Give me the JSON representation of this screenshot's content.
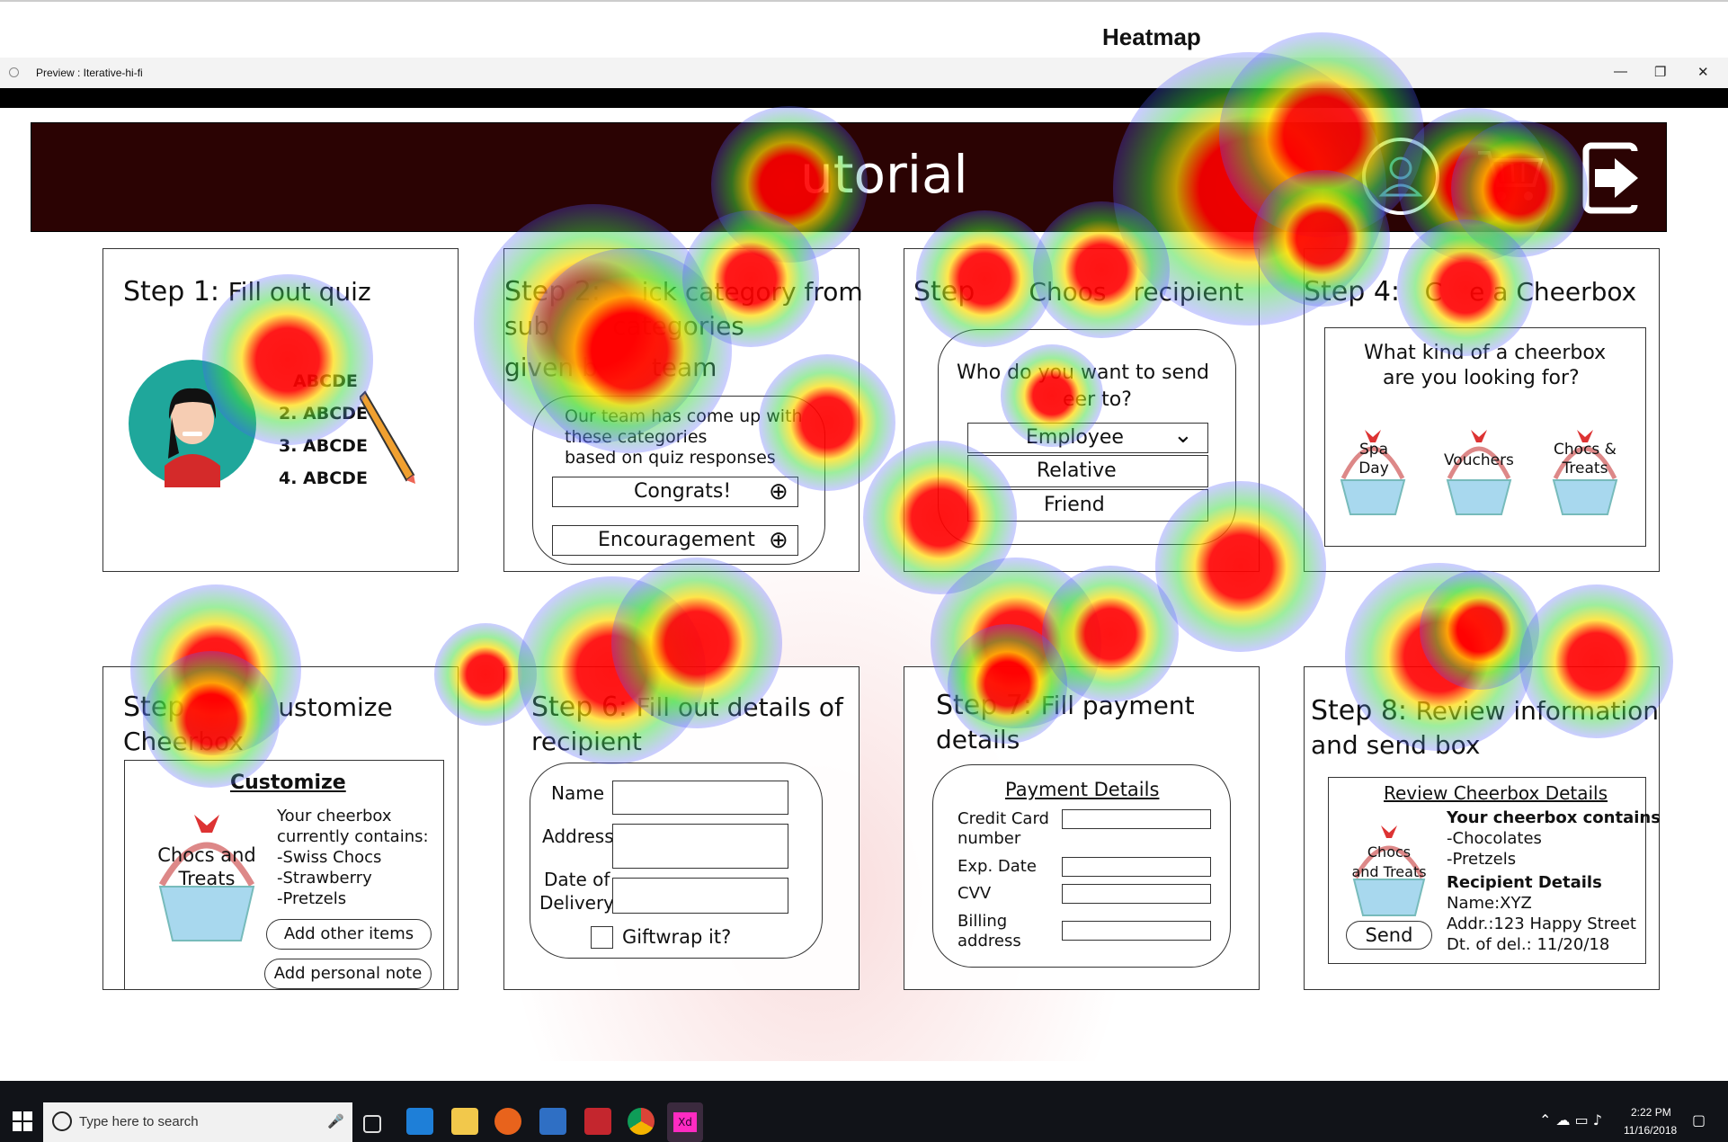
{
  "page_title": "Heatmap",
  "window": {
    "title": "Preview : Iterative-hi-fi",
    "minimize": "—",
    "restore": "❐",
    "close": "✕"
  },
  "banner": {
    "title_visible": "utorial",
    "bg_color": "#2b0303"
  },
  "steps": {
    "s1": {
      "label": "Step 1:",
      "title": "Fill out quiz",
      "quiz_rows": [
        "ABCDE",
        "2. ABCDE",
        "3. ABCDE",
        "4. ABCDE"
      ]
    },
    "s2": {
      "label": "Step 2:",
      "line1": "ick category from",
      "line2": "sub",
      "line2b": "categories",
      "line3": "given b",
      "line3b": "team",
      "intro": [
        "Our team has come up with",
        "these categories",
        "based on quiz responses"
      ],
      "cat1": "Congrats!",
      "cat2": "Encouragement"
    },
    "s3": {
      "label": "Step",
      "title": "Choos",
      "title2": "recipient",
      "question1": "Who do you want to send",
      "question2": "eer to?",
      "options": [
        "Employee",
        "Relative",
        "Friend"
      ]
    },
    "s4": {
      "label": "Step 4:",
      "title": "C",
      "title2": "e a Cheerbox",
      "question1": "What kind of a cheerbox",
      "question2": "are you looking for?",
      "baskets": [
        "Spa Day",
        "Vouchers",
        "Chocs & Treats"
      ]
    },
    "s5": {
      "label": "Step",
      "title": "ustomize",
      "title2": "Cheerbox",
      "heading": "Customize",
      "basket": "Chocs and Treats",
      "contents_title1": "Your cheerbox",
      "contents_title2": "currently contains:",
      "contents": [
        "-Swiss Chocs",
        "-Strawberry",
        "-Pretzels"
      ],
      "add_items": "Add other items",
      "add_note": "Add personal note"
    },
    "s6": {
      "label": "Step 6:",
      "title": "Fill out details of",
      "title2": "recipient",
      "name": "Name",
      "address": "Address",
      "date1": "Date of",
      "date2": "Delivery",
      "giftwrap": "Giftwrap it?"
    },
    "s7": {
      "label": "Step 7:",
      "title": "Fill payment",
      "title2": "details",
      "heading": "Payment Details",
      "cc1": "Credit Card",
      "cc2": "number",
      "exp": "Exp. Date",
      "cvv": "CVV",
      "bill1": "Billing",
      "bill2": "address"
    },
    "s8": {
      "label": "Step 8:",
      "title": "Review information",
      "title2": "and send box",
      "heading": "Review Cheerbox Details",
      "basket1": "Chocs",
      "basket2": "and Treats",
      "send": "Send",
      "contains_title": "Your cheerbox contains",
      "contains": [
        "-Chocolates",
        "-Pretzels"
      ],
      "recipient_title": "Recipient Details",
      "recipient": [
        "Name:XYZ",
        "Addr.:123 Happy Street",
        "Dt. of del.: 11/20/18"
      ]
    }
  },
  "taskbar": {
    "search_placeholder": "Type here to search",
    "time": "2:22 PM",
    "date": "11/16/2018"
  }
}
